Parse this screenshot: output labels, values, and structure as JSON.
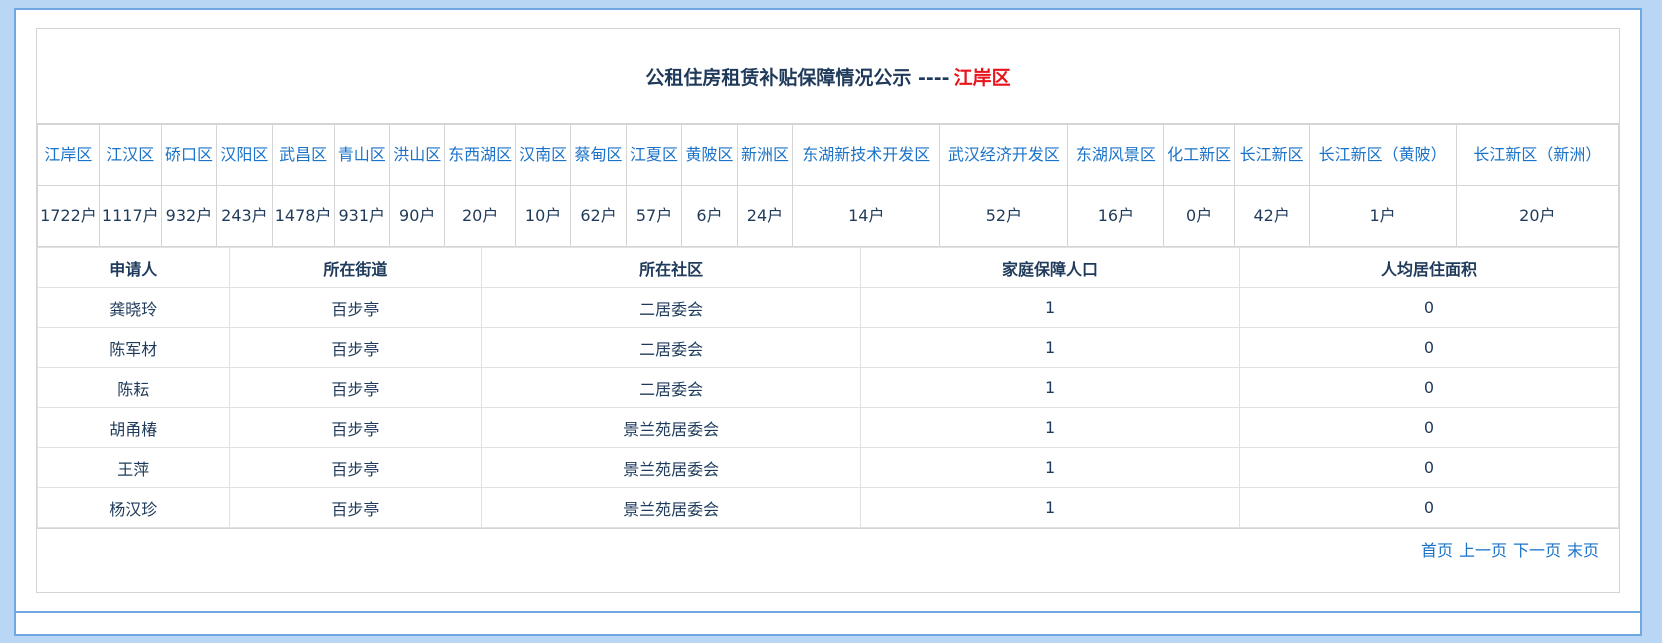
{
  "title": {
    "prefix": "公租住房租赁补贴保障情况公示 ----",
    "district": "江岸区"
  },
  "districts": [
    {
      "name": "江岸区",
      "count": "1722户"
    },
    {
      "name": "江汉区",
      "count": "1117户"
    },
    {
      "name": "硚口区",
      "count": "932户"
    },
    {
      "name": "汉阳区",
      "count": "243户"
    },
    {
      "name": "武昌区",
      "count": "1478户"
    },
    {
      "name": "青山区",
      "count": "931户"
    },
    {
      "name": "洪山区",
      "count": "90户"
    },
    {
      "name": "东西湖区",
      "count": "20户"
    },
    {
      "name": "汉南区",
      "count": "10户"
    },
    {
      "name": "蔡甸区",
      "count": "62户"
    },
    {
      "name": "江夏区",
      "count": "57户"
    },
    {
      "name": "黄陂区",
      "count": "6户"
    },
    {
      "name": "新洲区",
      "count": "24户"
    },
    {
      "name": "东湖新技术开发区",
      "count": "14户"
    },
    {
      "name": "武汉经济开发区",
      "count": "52户"
    },
    {
      "name": "东湖风景区",
      "count": "16户"
    },
    {
      "name": "化工新区",
      "count": "0户"
    },
    {
      "name": "长江新区",
      "count": "42户"
    },
    {
      "name": "长江新区（黄陂）",
      "count": "1户"
    },
    {
      "name": "长江新区（新洲）",
      "count": "20户"
    }
  ],
  "table": {
    "headers": [
      "申请人",
      "所在街道",
      "所在社区",
      "家庭保障人口",
      "人均居住面积"
    ],
    "rows": [
      [
        "龚晓玲",
        "百步亭",
        "二居委会",
        "1",
        "0"
      ],
      [
        "陈军材",
        "百步亭",
        "二居委会",
        "1",
        "0"
      ],
      [
        "陈耘",
        "百步亭",
        "二居委会",
        "1",
        "0"
      ],
      [
        "胡甬椿",
        "百步亭",
        "景兰苑居委会",
        "1",
        "0"
      ],
      [
        "王萍",
        "百步亭",
        "景兰苑居委会",
        "1",
        "0"
      ],
      [
        "杨汉珍",
        "百步亭",
        "景兰苑居委会",
        "1",
        "0"
      ]
    ]
  },
  "pager": {
    "first": "首页",
    "prev": "上一页",
    "next": "下一页",
    "last": "末页"
  }
}
